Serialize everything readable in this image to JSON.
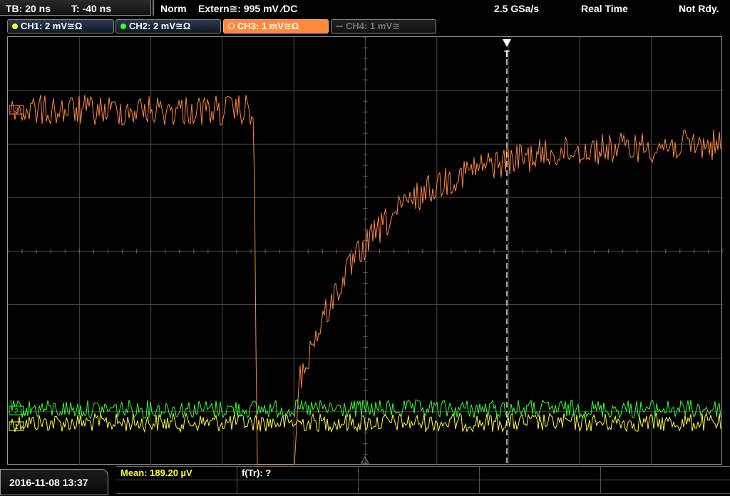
{
  "topbar": {
    "timebase": "TB: 20 ns",
    "trigger_time": "T: -40 ns",
    "mode": "Norm",
    "trigger_source": "Extern≅: 995 mV ∕DC",
    "sample_rate": "2.5 GSa/s",
    "acq_mode": "Real Time",
    "status": "Not Rdy."
  },
  "channels": [
    {
      "label": "CH1: 2 mV≅Ω",
      "color": "#ffff33",
      "state": "on"
    },
    {
      "label": "CH2: 2 mV≅Ω",
      "color": "#33ff33",
      "state": "on"
    },
    {
      "label": "CH3: 1 mV≅Ω",
      "color": "#ff8a3c",
      "state": "active"
    },
    {
      "label": "CH4: 1 mV≅",
      "color": "#666666",
      "state": "off"
    }
  ],
  "markers": {
    "ch3_marker": "3",
    "ch2_marker": "2",
    "ch1_marker": "1",
    "trigger_marker": "T"
  },
  "bottombar": {
    "datetime": "2016-11-08 13:37",
    "mean": "Mean: 189.20 µV",
    "rise_time": "f(Tr): ?"
  },
  "colors": {
    "ch1": "#ffff33",
    "ch2": "#33ff33",
    "ch3": "#ff8a3c",
    "grid": "#555555",
    "mean_text": "#ffff33"
  }
}
